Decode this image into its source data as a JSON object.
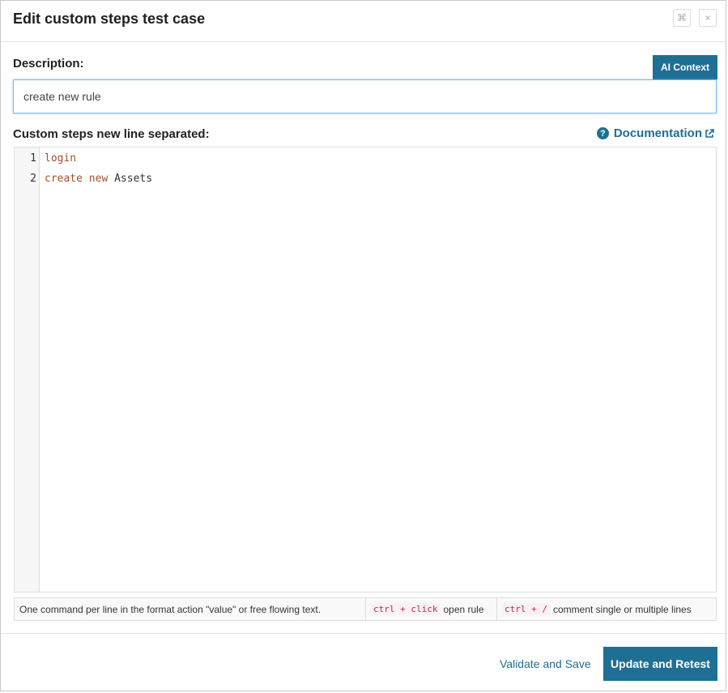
{
  "header": {
    "title": "Edit custom steps test case",
    "expand_icon": "⌘",
    "close_icon": "×"
  },
  "description": {
    "label": "Description:",
    "value": "create new rule",
    "ai_context_label": "AI Context"
  },
  "steps": {
    "label": "Custom steps new line separated:",
    "documentation_label": "Documentation",
    "lines": [
      {
        "num": "1",
        "tokens": [
          {
            "text": "login",
            "kw": true
          }
        ]
      },
      {
        "num": "2",
        "tokens": [
          {
            "text": "create",
            "kw": true
          },
          {
            "text": " "
          },
          {
            "text": "new",
            "kw": true
          },
          {
            "text": " Assets"
          }
        ]
      }
    ]
  },
  "hints": {
    "format": "One command per line in the format action \"value\" or free flowing text.",
    "open_rule_kbd": "ctrl + click",
    "open_rule_text": "open rule",
    "comment_kbd": "ctrl + /",
    "comment_text": "comment single or multiple lines"
  },
  "footer": {
    "validate_label": "Validate and Save",
    "update_label": "Update and Retest"
  },
  "colors": {
    "primary": "#1f6f95",
    "keyword": "#a0522d"
  }
}
